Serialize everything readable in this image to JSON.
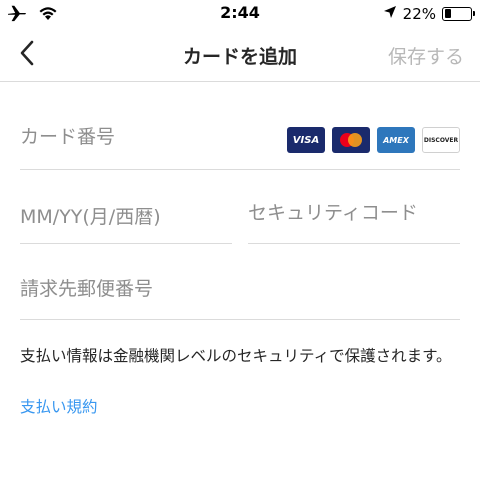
{
  "status_bar": {
    "time": "2:44",
    "battery_percent_label": "22%",
    "battery_level": 0.22,
    "icons": [
      "airplane-icon",
      "wifi-icon",
      "location-arrow-icon",
      "battery-icon"
    ]
  },
  "nav": {
    "back_icon": "chevron-left-icon",
    "title": "カードを追加",
    "save_label": "保存する"
  },
  "form": {
    "card_number": {
      "placeholder": "カード番号",
      "value": ""
    },
    "card_brands": [
      "VISA",
      "Mastercard",
      "AMEX",
      "DISCOVER"
    ],
    "expiry": {
      "placeholder": "MM/YY(月/西暦)",
      "value": ""
    },
    "security_code": {
      "placeholder": "セキュリティコード",
      "value": ""
    },
    "postal_code": {
      "placeholder": "請求先郵便番号",
      "value": ""
    }
  },
  "info": {
    "text": "支払い情報は金融機関レベルのセキュリティで保護されます。",
    "link_label": "支払い規約"
  },
  "colors": {
    "link": "#3897f0",
    "disabled": "#b8b8b8",
    "divider": "#dbdbdb"
  }
}
